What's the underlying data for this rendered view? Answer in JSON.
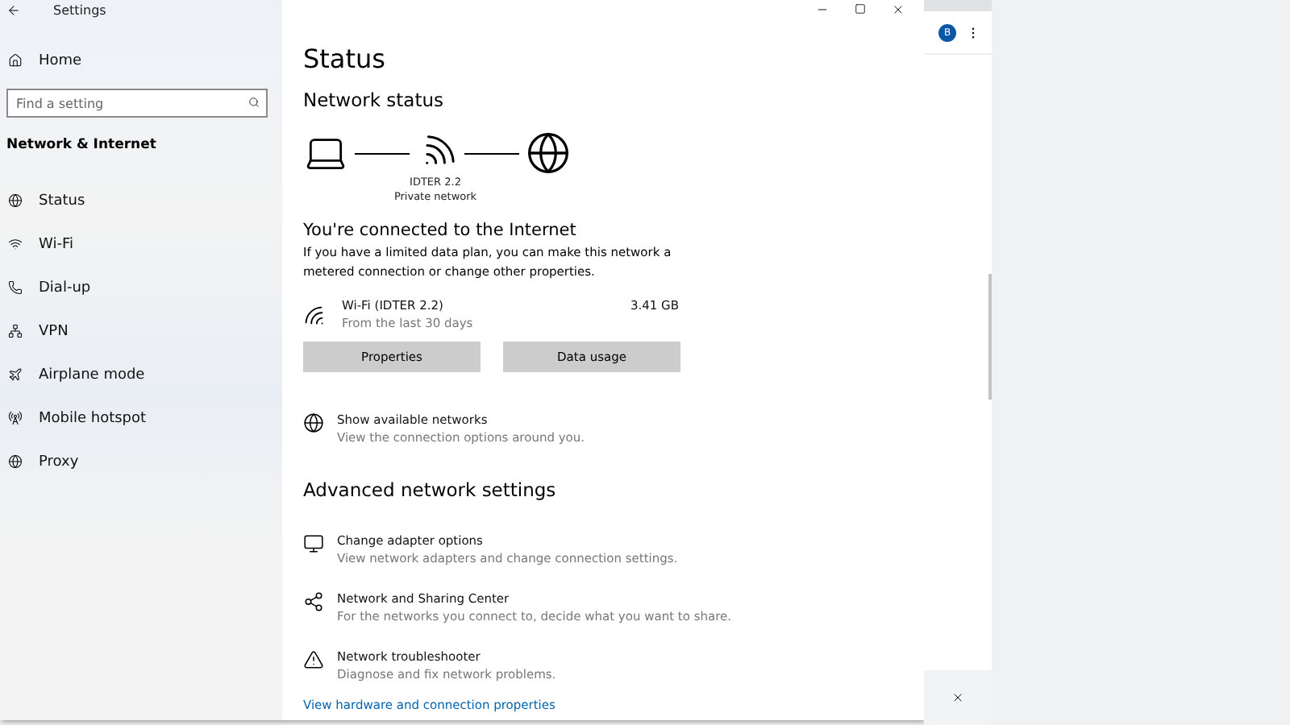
{
  "window": {
    "title": "Settings"
  },
  "sidebar": {
    "home": "Home",
    "search": {
      "placeholder": "Find a setting"
    },
    "section": "Network & Internet",
    "items": [
      {
        "kind": "status",
        "label": "Status"
      },
      {
        "kind": "wifi",
        "label": "Wi-Fi"
      },
      {
        "kind": "dialup",
        "label": "Dial-up"
      },
      {
        "kind": "vpn",
        "label": "VPN"
      },
      {
        "kind": "airplane",
        "label": "Airplane mode"
      },
      {
        "kind": "hotspot",
        "label": "Mobile hotspot"
      },
      {
        "kind": "proxy",
        "label": "Proxy"
      }
    ]
  },
  "content": {
    "title": "Status",
    "network_status": {
      "heading": "Network status",
      "network_name": "IDTER 2.2",
      "network_type": "Private network"
    },
    "connection": {
      "heading": "You're connected to the Internet",
      "description": "If you have a limited data plan, you can make this network a metered connection or change other properties."
    },
    "usage": {
      "name": "Wi-Fi (IDTER 2.2)",
      "period": "From the last 30 days",
      "amount": "3.41 GB"
    },
    "buttons": [
      "Properties",
      "Data usage"
    ],
    "show_networks": {
      "kind": "globe",
      "title": "Show available networks",
      "subtitle": "View the connection options around you."
    },
    "advanced": {
      "heading": "Advanced network settings",
      "items": [
        {
          "kind": "adapter",
          "title": "Change adapter options",
          "subtitle": "View network adapters and change connection settings."
        },
        {
          "kind": "sharing",
          "title": "Network and Sharing Center",
          "subtitle": "For the networks you connect to, decide what you want to share."
        },
        {
          "kind": "troubleshoot",
          "title": "Network troubleshooter",
          "subtitle": "Diagnose and fix network problems."
        }
      ]
    },
    "link": "View hardware and connection properties"
  },
  "browser": {
    "avatar": "B"
  }
}
